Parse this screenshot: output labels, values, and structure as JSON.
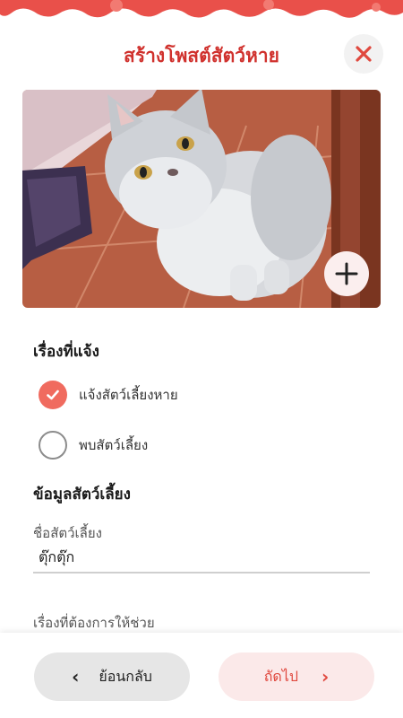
{
  "header": {
    "title": "สร้างโพสต์สัตว์หาย",
    "close_icon": "close-icon"
  },
  "photo": {
    "description_icon": "photo-image",
    "add_icon": "plus-icon"
  },
  "report_type": {
    "title": "เรื่องที่แจ้ง",
    "options": [
      {
        "label": "แจ้งสัตว์เลี้ยงหาย",
        "checked": true
      },
      {
        "label": "พบสัตว์เลี้ยง",
        "checked": false
      }
    ]
  },
  "pet_info": {
    "title": "ข้อมูลสัตว์เลี้ยง",
    "name_label": "ชื่อสัตว์เลี้ยง",
    "name_value": "ตุ๊กตุ๊ก",
    "help_label": "เรื่องที่ต้องการให้ช่วย"
  },
  "footer": {
    "back_label": "ย้อนกลับ",
    "next_label": "ถัดไป"
  },
  "colors": {
    "accent": "#d0312d",
    "check": "#f06b5f",
    "next_bg": "#fbe9e9",
    "back_bg": "#e6e6e6"
  }
}
